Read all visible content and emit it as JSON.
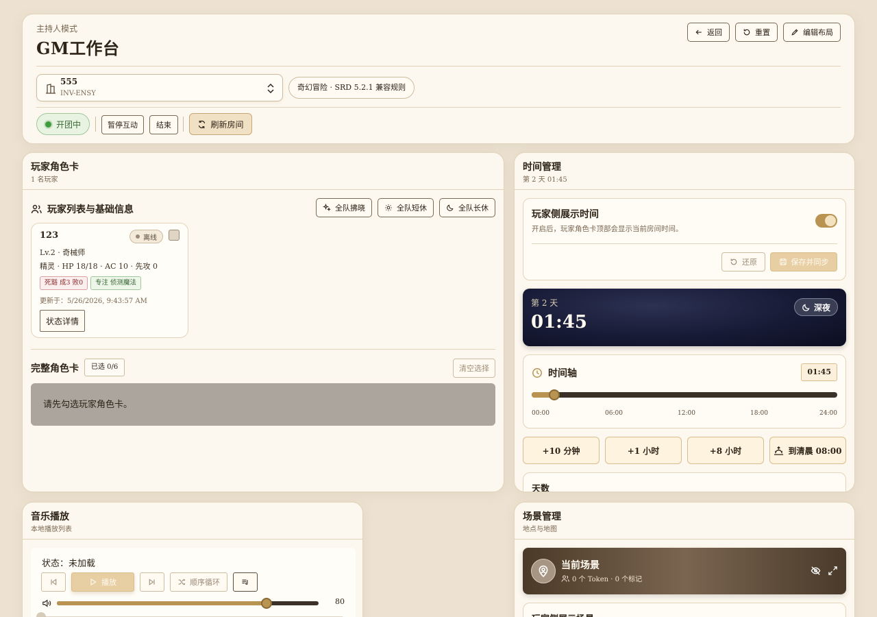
{
  "header": {
    "mode_label": "主持人模式",
    "title": "GM工作台",
    "back_label": "返回",
    "reset_label": "重置",
    "edit_layout_label": "编辑布局",
    "room": {
      "name": "555",
      "code": "INV-ENSY"
    },
    "rules_label": "奇幻冒险 · SRD 5.2.1 兼容规则",
    "status_label": "开团中",
    "pause_label": "暂停互动",
    "end_label": "结束",
    "refresh_label": "刷新房间"
  },
  "players": {
    "title": "玩家角色卡",
    "subtitle": "1 名玩家",
    "section_title": "玩家列表与基础信息",
    "dawn_label": "全队拂晓",
    "short_rest_label": "全队短休",
    "long_rest_label": "全队长休",
    "card": {
      "name": "123",
      "status": "离线",
      "level_class": "Lv.2 · 奇械师",
      "stats": "精灵 · HP 18/18 · AC 10 · 先攻 0",
      "death_tag": "死豁 成3 败0",
      "focus_tag": "专注 侦测魔法",
      "updated": "更新于：5/26/2026, 9:43:57 AM",
      "detail_label": "状态详情"
    },
    "full_title": "完整角色卡",
    "selected_label": "已选 0/6",
    "clear_label": "清空选择",
    "empty_hint": "请先勾选玩家角色卡。"
  },
  "time": {
    "title": "时间管理",
    "subtitle": "第 2 天 01:45",
    "display_title": "玩家侧展示时间",
    "display_desc": "开启后，玩家角色卡顶部会显示当前房间时间。",
    "display_enabled": true,
    "restore_label": "还原",
    "save_sync_label": "保存并同步",
    "day_label": "第 2 天",
    "clock": "01:45",
    "phase_label": "深夜",
    "timeline_title": "时间轴",
    "timeline_badge": "01:45",
    "timeline_fraction": 0.0729,
    "ticks": [
      "00:00",
      "06:00",
      "12:00",
      "18:00",
      "24:00"
    ],
    "add_10m": "+10 分钟",
    "add_1h": "+1 小时",
    "add_8h": "+8 小时",
    "to_dawn": "到清晨 08:00",
    "days_label": "天数"
  },
  "music": {
    "title": "音乐播放",
    "subtitle": "本地播放列表",
    "status": "状态：未加载",
    "play_label": "播放",
    "loop_label": "顺序循环",
    "volume": 80
  },
  "scenes": {
    "title": "场景管理",
    "subtitle": "地点与地图",
    "current_title": "当前场景",
    "current_meta": "0 个 Token · 0 个标记",
    "player_scene_title": "玩家侧展示场景"
  }
}
